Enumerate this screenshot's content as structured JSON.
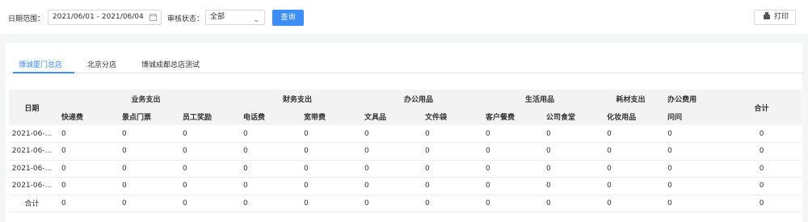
{
  "filters": {
    "date_range_label": "日期范围：",
    "date_range_value": "2021/06/01 - 2021/06/04",
    "status_label": "审核状态：",
    "status_value": "全部",
    "query_button": "查询",
    "print_button": "打印"
  },
  "tabs": [
    {
      "label": "博诚厦门总店",
      "active": true
    },
    {
      "label": "北京分店",
      "active": false
    },
    {
      "label": "博诚成都总店测试",
      "active": false
    }
  ],
  "table": {
    "date_header": "日期",
    "total_header": "合计",
    "groups": [
      "业务支出",
      "财务支出",
      "办公用品",
      "生活用品",
      "耗材支出",
      "办公费用"
    ],
    "columns": [
      "快递费",
      "景点门票",
      "员工奖励",
      "电话费",
      "宽带费",
      "文具品",
      "文件袋",
      "客户餐费",
      "公司食堂",
      "化妆用品",
      "问问"
    ],
    "rows": [
      {
        "date": "2021-06-...",
        "values": [
          "0",
          "0",
          "0",
          "0",
          "0",
          "0",
          "0",
          "0",
          "0",
          "0",
          "0"
        ],
        "total": "0"
      },
      {
        "date": "2021-06-...",
        "values": [
          "0",
          "0",
          "0",
          "0",
          "0",
          "0",
          "0",
          "0",
          "0",
          "0",
          "0"
        ],
        "total": "0"
      },
      {
        "date": "2021-06-...",
        "values": [
          "0",
          "0",
          "0",
          "0",
          "0",
          "0",
          "0",
          "0",
          "0",
          "0",
          "0"
        ],
        "total": "0"
      },
      {
        "date": "2021-06-...",
        "values": [
          "0",
          "0",
          "0",
          "0",
          "0",
          "0",
          "0",
          "0",
          "0",
          "0",
          "0"
        ],
        "total": "0"
      },
      {
        "date": "合计",
        "values": [
          "0",
          "0",
          "0",
          "0",
          "0",
          "0",
          "0",
          "0",
          "0",
          "0",
          "0"
        ],
        "total": "0"
      }
    ]
  },
  "colors": {
    "accent": "#3e8ef7"
  }
}
